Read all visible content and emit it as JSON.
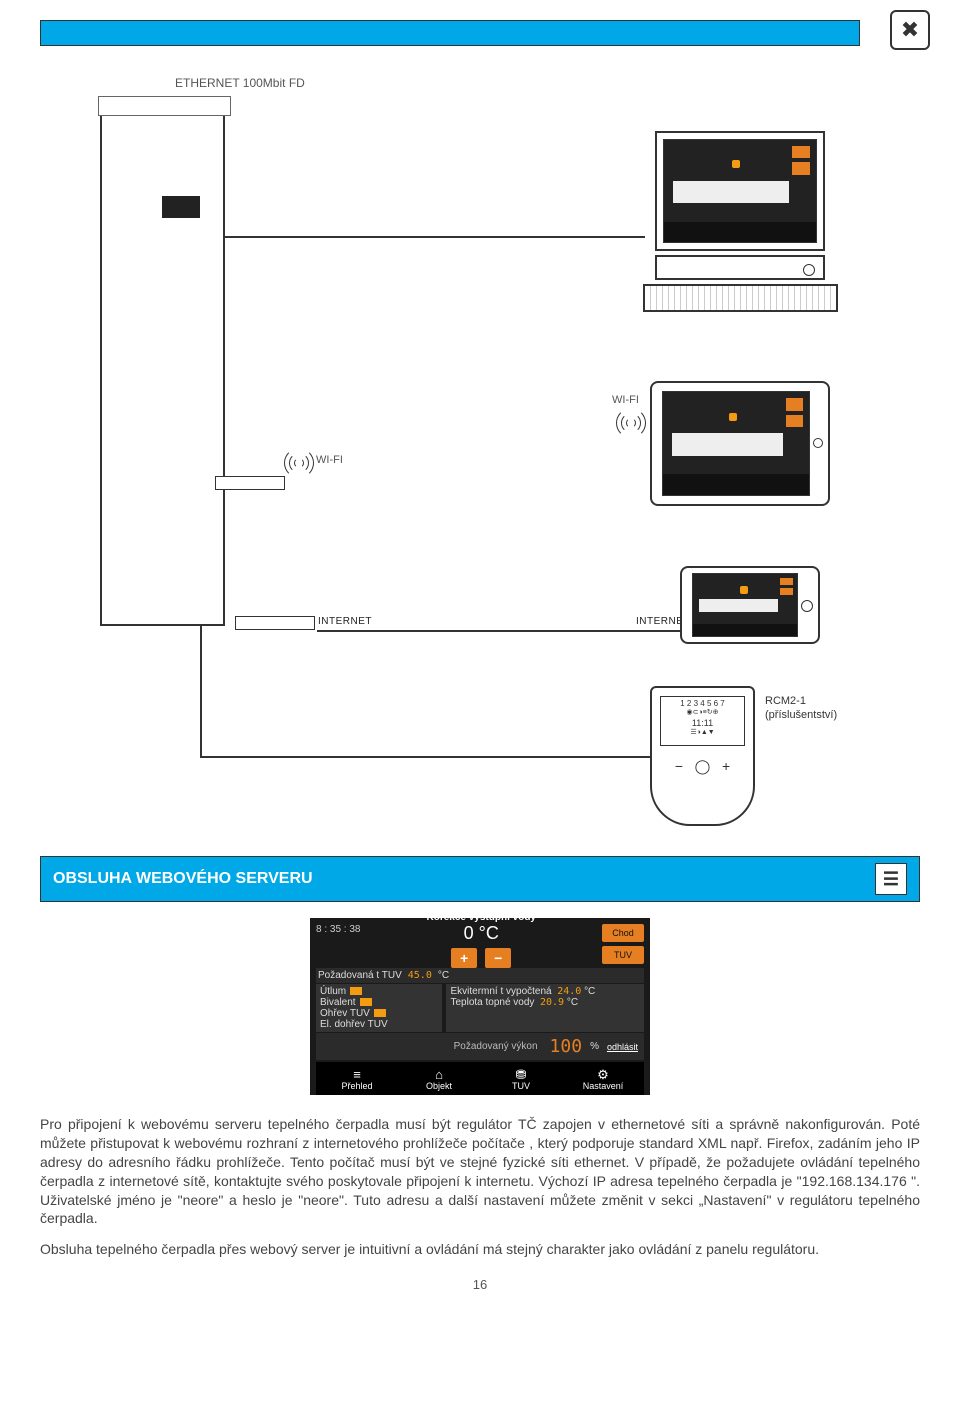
{
  "diagram": {
    "ethernet_label": "ETHERNET 100Mbit FD",
    "wifi_label_1": "WI-FI",
    "wifi_label_2": "WI-FI",
    "internet_label_1": "INTERNET",
    "internet_label_2": "INTERNET",
    "rcm_name": "RCM2-1",
    "rcm_note": "(příslušentství)",
    "rcm_display_top": "1 2 3 4 5 6 7",
    "rcm_display_mid": "—",
    "rcm_display_time": "11:11"
  },
  "section": {
    "title": "OBSLUHA WEBOVÉHO SERVERU"
  },
  "server_screenshot": {
    "time": "8 : 35 : 38",
    "mode_button": "Chod",
    "tuv_button": "TUV",
    "correction_title": "Korekce výstupní vody",
    "correction_value": "0 °C",
    "plus": "+",
    "minus": "−",
    "req_tuv_label": "Požadovaná t TUV",
    "req_tuv_value": "45.0",
    "req_tuv_unit": "°C",
    "left_rows": [
      "Útlum",
      "Bivalent",
      "Ohřev TUV",
      "El. dohřev TUV"
    ],
    "right_rows": [
      {
        "label": "Ekvitermní t vypočtená",
        "value": "24.0",
        "unit": "°C"
      },
      {
        "label": "Teplota topné vody",
        "value": "20.9",
        "unit": "°C"
      }
    ],
    "power_label": "Požadovaný výkon",
    "power_value": "100",
    "power_unit": "%",
    "logout": "odhlásit",
    "nav": [
      "Přehled",
      "Objekt",
      "TUV",
      "Nastavení"
    ]
  },
  "text": {
    "p1": "Pro připojení k webovému serveru tepelného čerpadla musí být regulátor TČ zapojen v ethernetové síti a správně nakonfigurován. Poté můžete přistupovat k webovému rozhraní z internetového prohlížeče počítače , který podporuje standard XML např. Firefox, zadáním jeho IP adresy do adresního řádku prohlížeče. Tento počítač musí být ve stejné fyzické síti ethernet. V případě, že požadujete ovládání tepelného čerpadla z internetové sítě, kontaktujte svého poskytovale připojení k internetu. Výchozí IP adresa tepelného čerpadla je \"192.168.134.176 \". Uživatelské jméno je \"neore\" a heslo je \"neore\". Tuto adresu a další nastavení můžete změnit v sekci „Nastavení\" v regulátoru tepelného čerpadla.",
    "p2": "Obsluha tepelného čerpadla přes webový server je intuitivní a ovládání má stejný charakter jako ovládání z panelu regulátoru.",
    "page_number": "16"
  }
}
